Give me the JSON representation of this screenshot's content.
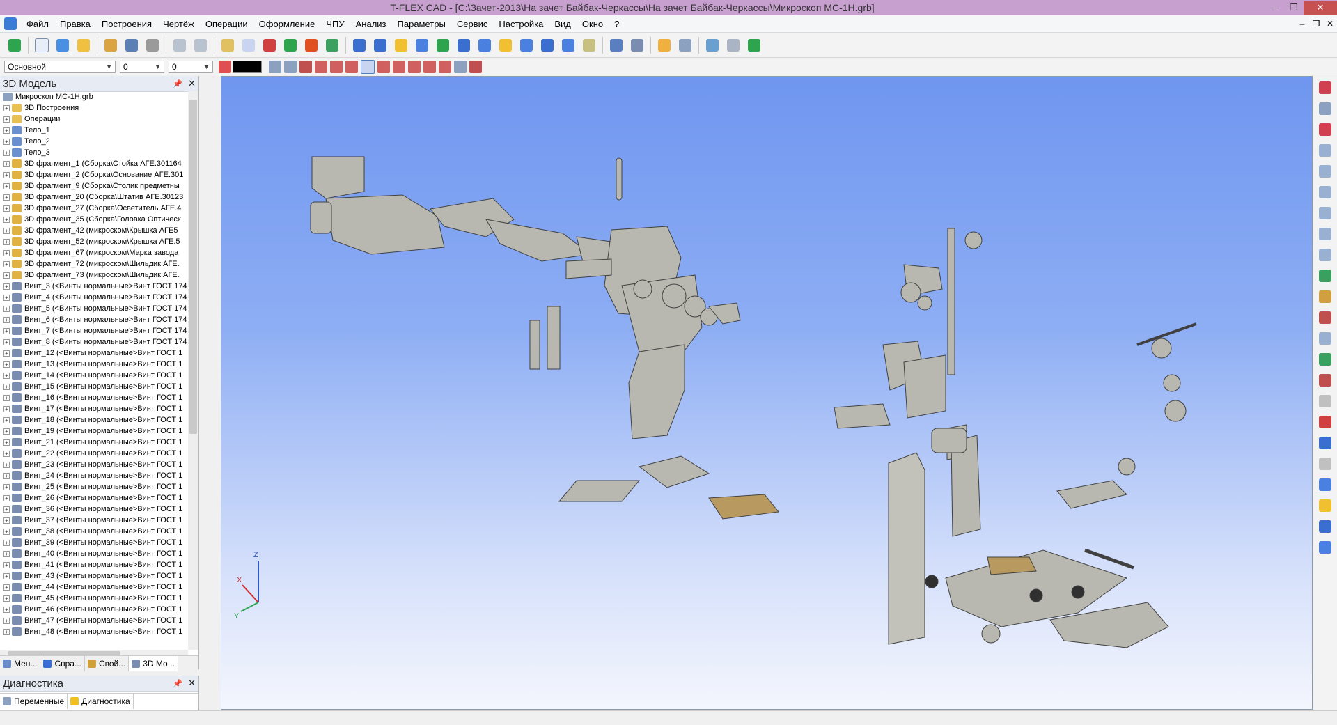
{
  "window": {
    "title": "T-FLEX CAD - [C:\\Зачет-2013\\На зачет Байбак-Черкассы\\На зачет Байбак-Черкассы\\Микроскоп МС-1Н.grb]"
  },
  "menu": [
    "Файл",
    "Правка",
    "Построения",
    "Чертёж",
    "Операции",
    "Оформление",
    "ЧПУ",
    "Анализ",
    "Параметры",
    "Сервис",
    "Настройка",
    "Вид",
    "Окно",
    "?"
  ],
  "toolbar2": {
    "layer": "Основной",
    "value1": "0",
    "value2": "0"
  },
  "model_panel": {
    "title": "3D Модель",
    "root": "Микроскоп МС-1Н.grb",
    "items": [
      "3D Построения",
      "Операции",
      "Тело_1",
      "Тело_2",
      "Тело_3",
      "3D фрагмент_1 (Сборка\\Стойка АГЕ.301164",
      "3D фрагмент_2 (Сборка\\Основание АГЕ.301",
      "3D фрагмент_9 (Сборка\\Столик предметны",
      "3D фрагмент_20 (Сборка\\Штатив АГЕ.30123",
      "3D фрагмент_27 (Сборка\\Осветитель АГЕ.4",
      "3D фрагмент_35 (Сборка\\Головка Оптическ",
      "3D фрагмент_42 (микроском\\Крышка АГЕ5",
      "3D фрагмент_52 (микроском\\Крышка АГЕ.5",
      "3D фрагмент_67 (микроском\\Марка завода",
      "3D фрагмент_72 (микроском\\Шильдик АГЕ.",
      "3D фрагмент_73 (микроском\\Шильдик АГЕ.",
      "Винт_3 (<Винты нормальные>Винт ГОСТ 174",
      "Винт_4 (<Винты нормальные>Винт ГОСТ 174",
      "Винт_5 (<Винты нормальные>Винт ГОСТ 174",
      "Винт_6 (<Винты нормальные>Винт ГОСТ 174",
      "Винт_7 (<Винты нормальные>Винт ГОСТ 174",
      "Винт_8 (<Винты нормальные>Винт ГОСТ 174",
      "Винт_12 (<Винты нормальные>Винт ГОСТ 1",
      "Винт_13 (<Винты нормальные>Винт ГОСТ 1",
      "Винт_14 (<Винты нормальные>Винт ГОСТ 1",
      "Винт_15 (<Винты нормальные>Винт ГОСТ 1",
      "Винт_16 (<Винты нормальные>Винт ГОСТ 1",
      "Винт_17 (<Винты нормальные>Винт ГОСТ 1",
      "Винт_18 (<Винты нормальные>Винт ГОСТ 1",
      "Винт_19 (<Винты нормальные>Винт ГОСТ 1",
      "Винт_21 (<Винты нормальные>Винт ГОСТ 1",
      "Винт_22 (<Винты нормальные>Винт ГОСТ 1",
      "Винт_23 (<Винты нормальные>Винт ГОСТ 1",
      "Винт_24 (<Винты нормальные>Винт ГОСТ 1",
      "Винт_25 (<Винты нормальные>Винт ГОСТ 1",
      "Винт_26 (<Винты нормальные>Винт ГОСТ 1",
      "Винт_36 (<Винты нормальные>Винт ГОСТ 1",
      "Винт_37 (<Винты нормальные>Винт ГОСТ 1",
      "Винт_38 (<Винты нормальные>Винт ГОСТ 1",
      "Винт_39 (<Винты нормальные>Винт ГОСТ 1",
      "Винт_40 (<Винты нормальные>Винт ГОСТ 1",
      "Винт_41 (<Винты нормальные>Винт ГОСТ 1",
      "Винт_43 (<Винты нормальные>Винт ГОСТ 1",
      "Винт_44 (<Винты нормальные>Винт ГОСТ 1",
      "Винт_45 (<Винты нормальные>Винт ГОСТ 1",
      "Винт_46 (<Винты нормальные>Винт ГОСТ 1",
      "Винт_47 (<Винты нормальные>Винт ГОСТ 1",
      "Винт_48 (<Винты нормальные>Винт ГОСТ 1"
    ]
  },
  "left_tabs": [
    "Мен...",
    "Спра...",
    "Свой...",
    "3D Мо..."
  ],
  "diag_panel": {
    "title": "Диагностика",
    "tabs": [
      "Переменные",
      "Диагностика"
    ]
  },
  "axes": {
    "x": "X",
    "y": "Y",
    "z": "Z"
  }
}
